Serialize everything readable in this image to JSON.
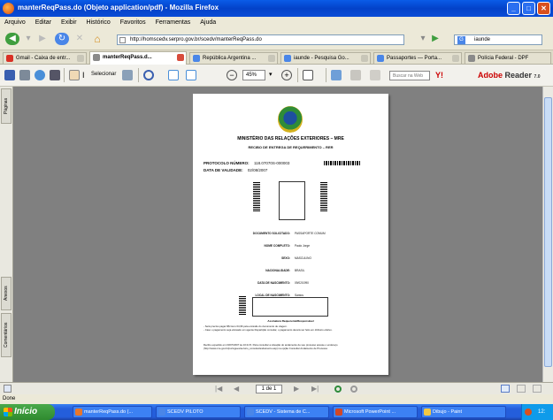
{
  "window": {
    "title": "manterReqPass.do (Objeto application/pdf) - Mozilla Firefox",
    "controls": [
      "_",
      "□",
      "✕"
    ]
  },
  "menu": [
    "Arquivo",
    "Editar",
    "Exibir",
    "Histórico",
    "Favoritos",
    "Ferramentas",
    "Ajuda"
  ],
  "navigation": {
    "url": "http://homscedv.serpro.gov.br/scedv/manterReqPass.do",
    "search_value": "iaunde"
  },
  "tabs": [
    {
      "label": "Gmail - Caixa de entr...",
      "active": false,
      "color": "#d93025"
    },
    {
      "label": "manterReqPass.d...",
      "active": true,
      "color": "#8a8a8a"
    },
    {
      "label": "República Argentina ...",
      "active": false,
      "color": "#4a86e8"
    },
    {
      "label": "iaunde - Pesquisa Go...",
      "active": false,
      "color": "#4a86e8"
    },
    {
      "label": "Passaportes — Porta...",
      "active": false,
      "color": "#4a86e8"
    },
    {
      "label": "Polícia Federal - DPF",
      "active": false,
      "color": "#8a8a8a"
    }
  ],
  "pdf_toolbar": {
    "select_label": "Selecionar",
    "zoom": "45%",
    "find_placeholder": "Buscar na Web",
    "adobe_logo": "Adobe",
    "adobe_logo_suffix": "Reader",
    "adobe_version": "7.0"
  },
  "side_tabs": {
    "pages": "Páginas",
    "attachments": "Anexos",
    "comments": "Comentários"
  },
  "document": {
    "heading": "MINISTÉRIO DAS RELAÇÕES EXTERIORES – MRE",
    "subheading": "RECIBO DE ENTREGA DE REQUERIMENTO – RER",
    "protocol_label": "PROTOCOLO NÚMERO:",
    "protocol_value": "118.07070S-000003",
    "validity_label": "DATA DE VALIDADE:",
    "validity_value": "02/08/2007",
    "fields": [
      {
        "label": "DOCUMENTO SOLICITADO:",
        "value": "PASSAPORTE COMUM"
      },
      {
        "label": "NOME COMPLETO:",
        "value": "Paulo Jorge"
      },
      {
        "label": "SEXO:",
        "value": "MASCULINO"
      },
      {
        "label": "NACIONALIDADE:",
        "value": "BRASIL"
      },
      {
        "label": "DATA DE NASCIMENTO:",
        "value": "09/02/1990"
      },
      {
        "label": "LOCAL DE NASCIMENTO:",
        "value": "Santos"
      }
    ],
    "signature_label": "Assinatura Requerente/Responsável",
    "notes": [
      "- Será preciso pagar R$ Guru 04,96 pela emissão do documento de viagem.",
      "- Caso o pagamento seja efetuado em agente Repartição consular, o pagamento deverá ser feito em dinheiro efetivo."
    ],
    "footer": "Recibo expedido em 03/07/2007 às 10:21:5. Para consultar a situação do andamento de seu processo acesse o endereço (http://www.mre.gov.br/portugues/servico_consular/andamento.asp) na opção Consultar Andamento de Processo."
  },
  "page_nav": {
    "page_indicator": "1 de 1"
  },
  "status": "Done",
  "taskbar": {
    "start": "Início",
    "tasks": [
      {
        "label": "manterReqPass.do (...",
        "color": "#e8762b"
      },
      {
        "label": "SCEDV PILOTO",
        "color": "#4a86e8"
      },
      {
        "label": "SCEDV - Sistema de C...",
        "color": "#4a86e8"
      },
      {
        "label": "Microsoft PowerPoint ...",
        "color": "#d24726"
      },
      {
        "label": "Dibujo - Paint",
        "color": "#f2c744"
      }
    ],
    "clock": "12:"
  }
}
